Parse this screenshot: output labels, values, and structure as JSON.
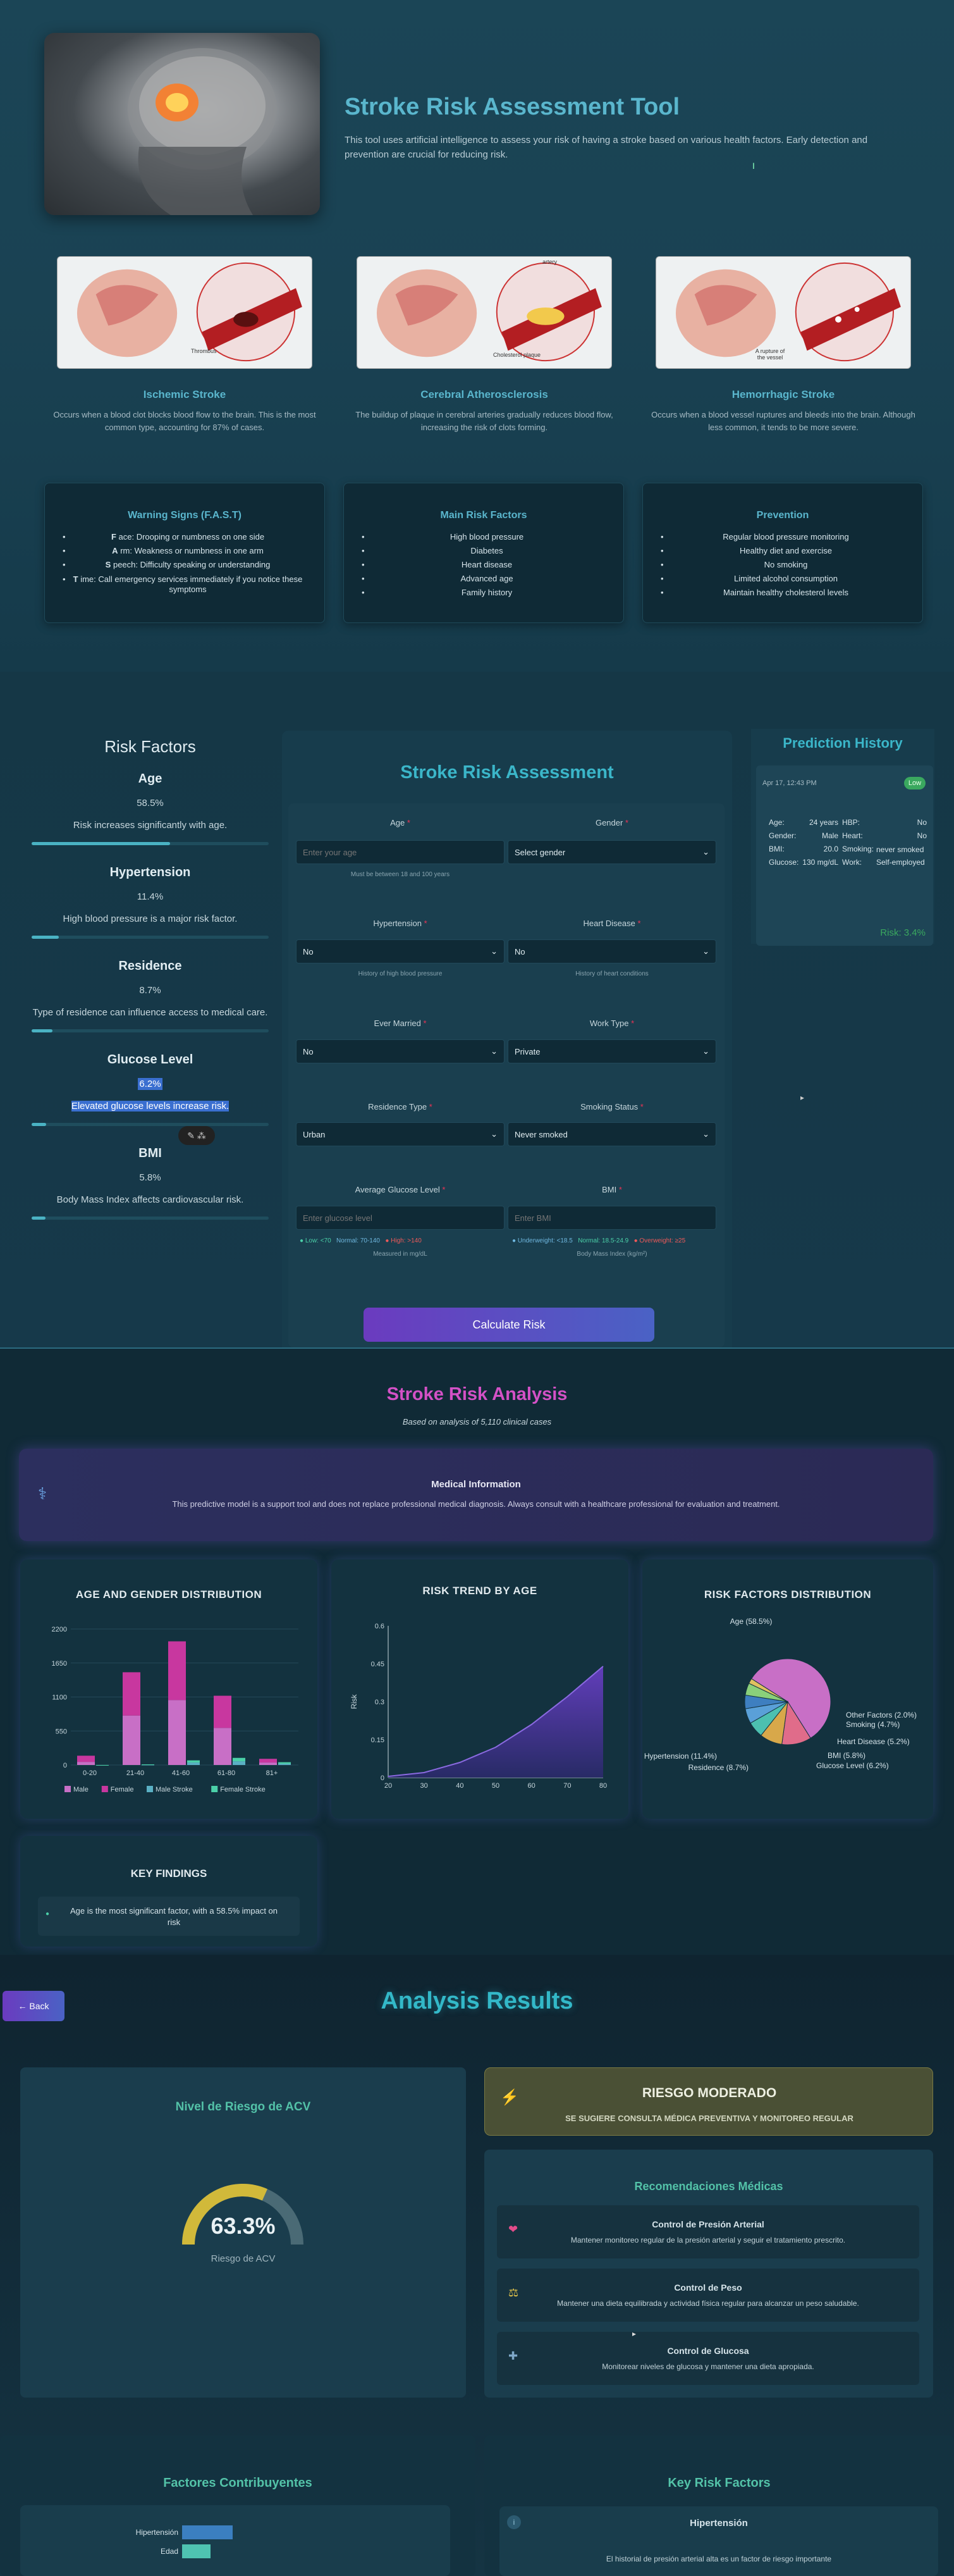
{
  "header": {
    "title": "Stroke Risk Assessment Tool",
    "intro": "This tool uses artificial intelligence to assess your risk of having a stroke based on various health factors. Early detection and prevention are crucial for reducing risk."
  },
  "types": [
    {
      "label_bottom": "Thrombus",
      "title": "Ischemic Stroke",
      "desc": "Occurs when a blood clot blocks blood flow to the brain. This is the most common type, accounting for 87% of cases."
    },
    {
      "label_top": "artery",
      "label_bottom": "Cholesterol plaque",
      "title": "Cerebral Atherosclerosis",
      "desc": "The buildup of plaque in cerebral arteries gradually reduces blood flow, increasing the risk of clots forming."
    },
    {
      "label_bottom": "A rupture of the vessel",
      "title": "Hemorrhagic Stroke",
      "desc": "Occurs when a blood vessel ruptures and bleeds into the brain. Although less common, it tends to be more severe."
    }
  ],
  "warning": {
    "title": "Warning Signs (F.A.S.T)",
    "items": [
      {
        "letter": "F",
        "rest": "ace: Drooping or numbness on one side"
      },
      {
        "letter": "A",
        "rest": "rm: Weakness or numbness in one arm"
      },
      {
        "letter": "S",
        "rest": "peech: Difficulty speaking or understanding"
      },
      {
        "letter": "T",
        "rest": "ime: Call emergency services immediately if you notice these symptoms"
      }
    ]
  },
  "main_factors": {
    "title": "Main Risk Factors",
    "items": [
      "High blood pressure",
      "Diabetes",
      "Heart disease",
      "Advanced age",
      "Family history"
    ]
  },
  "prevention": {
    "title": "Prevention",
    "items": [
      "Regular blood pressure monitoring",
      "Healthy diet and exercise",
      "No smoking",
      "Limited alcohol consumption",
      "Maintain healthy cholesterol levels"
    ]
  },
  "risk_factors": {
    "title": "Risk Factors",
    "items": [
      {
        "name": "Age",
        "pct": "58.5%",
        "desc": "Risk increases significantly with age.",
        "fill": 0.585
      },
      {
        "name": "Hypertension",
        "pct": "11.4%",
        "desc": "High blood pressure is a major risk factor.",
        "fill": 0.114
      },
      {
        "name": "Residence",
        "pct": "8.7%",
        "desc": "Type of residence can influence access to medical care.",
        "fill": 0.087
      },
      {
        "name": "Glucose Level",
        "pct": "6.2%",
        "desc": "Elevated glucose levels increase risk.",
        "fill": 0.062
      },
      {
        "name": "BMI",
        "pct": "5.8%",
        "desc": "Body Mass Index affects cardiovascular risk.",
        "fill": 0.058
      }
    ]
  },
  "form": {
    "title": "Stroke Risk Assessment",
    "age_label": "Age",
    "age_placeholder": "Enter your age",
    "age_hint": "Must be between 18 and 100 years",
    "gender_label": "Gender",
    "gender_value": "Select gender",
    "hyp_label": "Hypertension",
    "hyp_value": "No",
    "hyp_hint": "History of high blood pressure",
    "heart_label": "Heart Disease",
    "heart_value": "No",
    "heart_hint": "History of heart conditions",
    "married_label": "Ever Married",
    "married_value": "No",
    "work_label": "Work Type",
    "work_value": "Private",
    "res_label": "Residence Type",
    "res_value": "Urban",
    "smoke_label": "Smoking Status",
    "smoke_value": "Never smoked",
    "glucose_label": "Average Glucose Level",
    "glucose_placeholder": "Enter glucose level",
    "glucose_legend": {
      "low": "Low: <70",
      "normal": "Normal: 70-140",
      "high": "High: >140"
    },
    "glucose_unit": "Measured in mg/dL",
    "bmi_label": "BMI",
    "bmi_placeholder": "Enter BMI",
    "bmi_legend": {
      "under": "Underweight: <18.5",
      "normal": "Normal: 18.5-24.9",
      "over": "Overweight: ≥25"
    },
    "bmi_unit": "Body Mass Index (kg/m²)",
    "submit": "Calculate Risk"
  },
  "history": {
    "title": "Prediction History",
    "date": "Apr 17, 12:43 PM",
    "badge": "Low",
    "rows": [
      [
        "Age:",
        "24 years",
        "HBP:",
        "No"
      ],
      [
        "Gender:",
        "Male",
        "Heart:",
        "No"
      ],
      [
        "BMI:",
        "20.0",
        "Smoking:",
        "never smoked"
      ],
      [
        "Glucose:",
        "130 mg/dL",
        "Work:",
        "Self-employed"
      ]
    ],
    "risk": "Risk: 3.4%"
  },
  "analysis": {
    "title": "Stroke Risk Analysis",
    "subtitle": "Based on analysis of 5,110 clinical cases",
    "info_title": "Medical Information",
    "info_text": "This predictive model is a support tool and does not replace professional medical diagnosis. Always consult with a healthcare professional for evaluation and treatment.",
    "c1_title": "AGE AND GENDER DISTRIBUTION",
    "c2_title": "RISK TREND BY AGE",
    "c3_title": "RISK FACTORS DISTRIBUTION",
    "findings_title": "KEY FINDINGS",
    "finding": "Age is the most significant factor, with a 58.5% impact on risk"
  },
  "chart_data": [
    {
      "type": "bar",
      "title": "AGE AND GENDER DISTRIBUTION",
      "categories": [
        "0-20",
        "21-40",
        "41-60",
        "61-80",
        "81+"
      ],
      "ylim": [
        0,
        2200
      ],
      "yticks": [
        0,
        550,
        1100,
        1650,
        2200
      ],
      "series": [
        {
          "name": "Male",
          "values": [
            50,
            800,
            1050,
            600,
            40
          ],
          "color": "#c86fc6"
        },
        {
          "name": "Female",
          "values": [
            100,
            700,
            950,
            520,
            60
          ],
          "color": "#c8379f"
        },
        {
          "name": "Male Stroke",
          "values": [
            0,
            5,
            40,
            60,
            20
          ],
          "color": "#5ab0c4"
        },
        {
          "name": "Female Stroke",
          "values": [
            0,
            5,
            35,
            55,
            25
          ],
          "color": "#4bd0a8"
        }
      ]
    },
    {
      "type": "area",
      "title": "RISK TREND BY AGE",
      "ylabel": "Risk",
      "x": [
        20,
        30,
        40,
        50,
        60,
        70,
        80
      ],
      "y": [
        0.005,
        0.02,
        0.06,
        0.12,
        0.21,
        0.32,
        0.44
      ],
      "xlim": [
        20,
        80
      ],
      "ylim": [
        0,
        0.6
      ],
      "yticks": [
        0,
        0.15,
        0.3,
        0.45,
        0.6
      ]
    },
    {
      "type": "pie",
      "title": "RISK FACTORS DISTRIBUTION",
      "labels": [
        "Age (58.5%)",
        "Hypertension (11.4%)",
        "Residence (8.7%)",
        "Glucose Level (6.2%)",
        "BMI (5.8%)",
        "Heart Disease (5.2%)",
        "Smoking (4.7%)",
        "Other Factors (2.0%)"
      ],
      "values": [
        58.5,
        11.4,
        8.7,
        6.2,
        5.8,
        5.2,
        4.7,
        2.0
      ],
      "colors": [
        "#c86fc6",
        "#e06c8a",
        "#d8a84a",
        "#4cc0b0",
        "#5aa0d8",
        "#3e7fc0",
        "#8ad07a",
        "#e0c060"
      ]
    }
  ],
  "results": {
    "back": "← Back",
    "title": "Analysis Results",
    "gauge_title": "Nivel de Riesgo de ACV",
    "gauge_value": "63.3%",
    "gauge_fill": 0.633,
    "gauge_label": "Riesgo de ACV",
    "level": "RIESGO MODERADO",
    "level_sub": "SE SUGIERE CONSULTA MÉDICA PREVENTIVA Y MONITOREO REGULAR",
    "rec_title": "Recomendaciones Médicas",
    "recs": [
      {
        "title": "Control de Presión Arterial",
        "text": "Mantener monitoreo regular de la presión arterial y seguir el tratamiento prescrito."
      },
      {
        "title": "Control de Peso",
        "text": "Mantener una dieta equilibrada y actividad física regular para alcanzar un peso saludable."
      },
      {
        "title": "Control de Glucosa",
        "text": "Monitorear niveles de glucosa y mantener una dieta apropiada."
      }
    ],
    "contrib_title": "Factores Contribuyentes",
    "contrib": [
      {
        "label": "Hipertensión",
        "fill": 0.8
      },
      {
        "label": "Edad",
        "fill": 0.45
      }
    ],
    "key_title": "Key Risk Factors",
    "key_item": "Hipertensión",
    "key_text": "El historial de presión arterial alta es un factor de riesgo importante"
  }
}
